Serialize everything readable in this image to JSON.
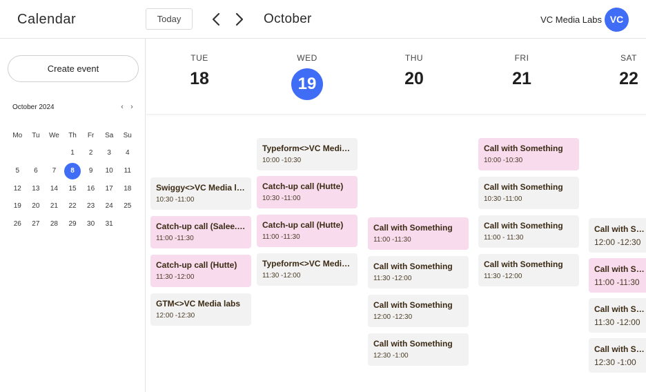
{
  "header": {
    "app_title": "Calendar",
    "today_label": "Today",
    "month_title": "October",
    "org_name": "VC Media Labs",
    "avatar_initials": "VC"
  },
  "sidebar": {
    "create_label": "Create event",
    "mini_title": "October 2024",
    "prev_glyph": "‹",
    "next_glyph": "›",
    "weekdays": [
      "Mo",
      "Tu",
      "We",
      "Th",
      "Fr",
      "Sa",
      "Su"
    ],
    "weeks": [
      [
        "",
        "",
        "",
        "1",
        "2",
        "3",
        "4"
      ],
      [
        "5",
        "6",
        "7",
        "8",
        "9",
        "10",
        "11"
      ],
      [
        "12",
        "13",
        "14",
        "15",
        "16",
        "17",
        "18"
      ],
      [
        "19",
        "20",
        "21",
        "22",
        "23",
        "24",
        "25"
      ],
      [
        "26",
        "27",
        "28",
        "29",
        "30",
        "31",
        ""
      ]
    ],
    "selected_day": "8"
  },
  "days": [
    {
      "dow": "TUE",
      "num": "18"
    },
    {
      "dow": "WED",
      "num": "19"
    },
    {
      "dow": "THU",
      "num": "20"
    },
    {
      "dow": "FRI",
      "num": "21"
    },
    {
      "dow": "SAT",
      "num": "22"
    }
  ],
  "events": {
    "tue": [
      {
        "title": "Swiggy<>VC Media labs",
        "time": "10:30 -11:00",
        "color": "grey"
      },
      {
        "title": "Catch-up call (Salee.ai)",
        "time": "11:00 -11:30",
        "color": "pink"
      },
      {
        "title": "Catch-up call (Hutte)",
        "time": "11:30 -12:00",
        "color": "pink"
      },
      {
        "title": "GTM<>VC Media labs",
        "time": "12:00 -12:30",
        "color": "grey"
      }
    ],
    "wed": [
      {
        "title": "Typeform<>VC Media labs",
        "time": "10:00 -10:30",
        "color": "grey"
      },
      {
        "title": "Catch-up call (Hutte)",
        "time": "10:30 -11:00",
        "color": "pink"
      },
      {
        "title": "Catch-up call (Hutte)",
        "time": "11:00 -11:30",
        "color": "pink"
      },
      {
        "title": "Typeform<>VC Media labs",
        "time": "11:30 -12:00",
        "color": "grey"
      }
    ],
    "thu": [
      {
        "title": "Call with Something",
        "time": "11:00 -11:30",
        "color": "pink"
      },
      {
        "title": "Call with Something",
        "time": "11:30 -12:00",
        "color": "grey"
      },
      {
        "title": "Call with Something",
        "time": "12:00 -12:30",
        "color": "grey"
      },
      {
        "title": "Call with Something",
        "time": "12:30 -1:00",
        "color": "grey"
      }
    ],
    "fri": [
      {
        "title": "Call with Something",
        "time": "10:00 -10:30",
        "color": "pink"
      },
      {
        "title": "Call with Something",
        "time": "10:30 -11:00",
        "color": "grey"
      },
      {
        "title": "Call with Something",
        "time": "11:00 - 11:30",
        "color": "grey"
      },
      {
        "title": "Call with Something",
        "time": "11:30 -12:00",
        "color": "grey"
      }
    ],
    "sat": [
      {
        "title": "Call with Something",
        "time": "12:00 -12:30",
        "color": "grey"
      },
      {
        "title": "Call with Something",
        "time": "11:00 -11:30",
        "color": "pink"
      },
      {
        "title": "Call with Something",
        "time": "11:30 -12:00",
        "color": "grey"
      },
      {
        "title": "Call with Something",
        "time": "12:30 -1:00",
        "color": "grey"
      }
    ]
  },
  "colors": {
    "accent": "#3f6df6",
    "event_grey": "#f2f2f2",
    "event_pink": "#f8dcee"
  }
}
